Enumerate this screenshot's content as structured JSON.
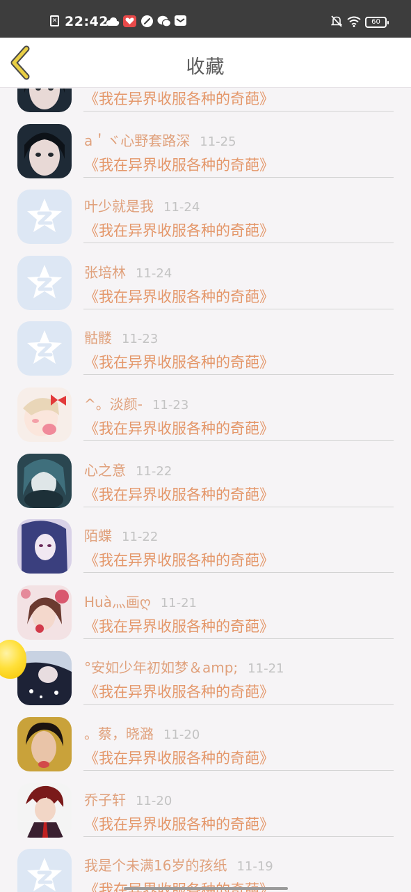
{
  "status_bar": {
    "time": "22:42",
    "battery": "60",
    "sim_icon": "no-sim-icon",
    "icons_left": [
      "cloud-icon",
      "weibo-icon",
      "game-icon",
      "wechat-icon",
      "mail-icon"
    ],
    "icons_right": [
      "mute-bell-icon",
      "wifi-icon",
      "battery-icon"
    ]
  },
  "header": {
    "title": "收藏",
    "back_icon": "chevron-left-icon"
  },
  "colors": {
    "name": "#e0a17c",
    "book": "#e4976a",
    "date": "#c3c3c3",
    "back_arrow": "#e9cf45"
  },
  "favorites": [
    {
      "name": "",
      "date": "",
      "book": "《我在异界收服各种的奇葩》",
      "avatar": "photo-girl-icon"
    },
    {
      "name": "a＇ヾ心野套路深",
      "date": "11-25",
      "book": "《我在异界收服各种的奇葩》",
      "avatar": "photo-girl-icon"
    },
    {
      "name": "叶少就是我",
      "date": "11-24",
      "book": "《我在异界收服各种的奇葩》",
      "avatar": "default-star-icon"
    },
    {
      "name": "张培林",
      "date": "11-24",
      "book": "《我在异界收服各种的奇葩》",
      "avatar": "default-star-icon"
    },
    {
      "name": "骷髅",
      "date": "11-23",
      "book": "《我在异界收服各种的奇葩》",
      "avatar": "default-star-icon"
    },
    {
      "name": "^。淡颜-",
      "date": "11-23",
      "book": "《我在异界收服各种的奇葩》",
      "avatar": "anime-bow-girl-icon"
    },
    {
      "name": "心之意",
      "date": "11-22",
      "book": "《我在异界收服各种的奇葩》",
      "avatar": "anime-teal-girl-icon"
    },
    {
      "name": "陌蝶",
      "date": "11-22",
      "book": "《我在异界收服各种的奇葩》",
      "avatar": "anime-blue-hair-icon"
    },
    {
      "name": "Huà灬画ღ",
      "date": "11-21",
      "book": "《我在异界收服各种的奇葩》",
      "avatar": "photo-flower-girl-icon"
    },
    {
      "name": "°安如少年初如梦＆amp;",
      "date": "11-21",
      "book": "《我在异界收服各种的奇葩》",
      "avatar": "photo-dark-girl-icon"
    },
    {
      "name": "。蔡，晓潞",
      "date": "11-20",
      "book": "《我在异界收服各种的奇葩》",
      "avatar": "photo-girl-selfie-icon"
    },
    {
      "name": "乔子轩",
      "date": "11-20",
      "book": "《我在异界收服各种的奇葩》",
      "avatar": "anime-red-hair-boy-icon"
    },
    {
      "name": "我是个未满16岁的孩纸",
      "date": "11-19",
      "book": "《我在异界收服各种的奇葩》",
      "avatar": "default-star-icon"
    }
  ]
}
